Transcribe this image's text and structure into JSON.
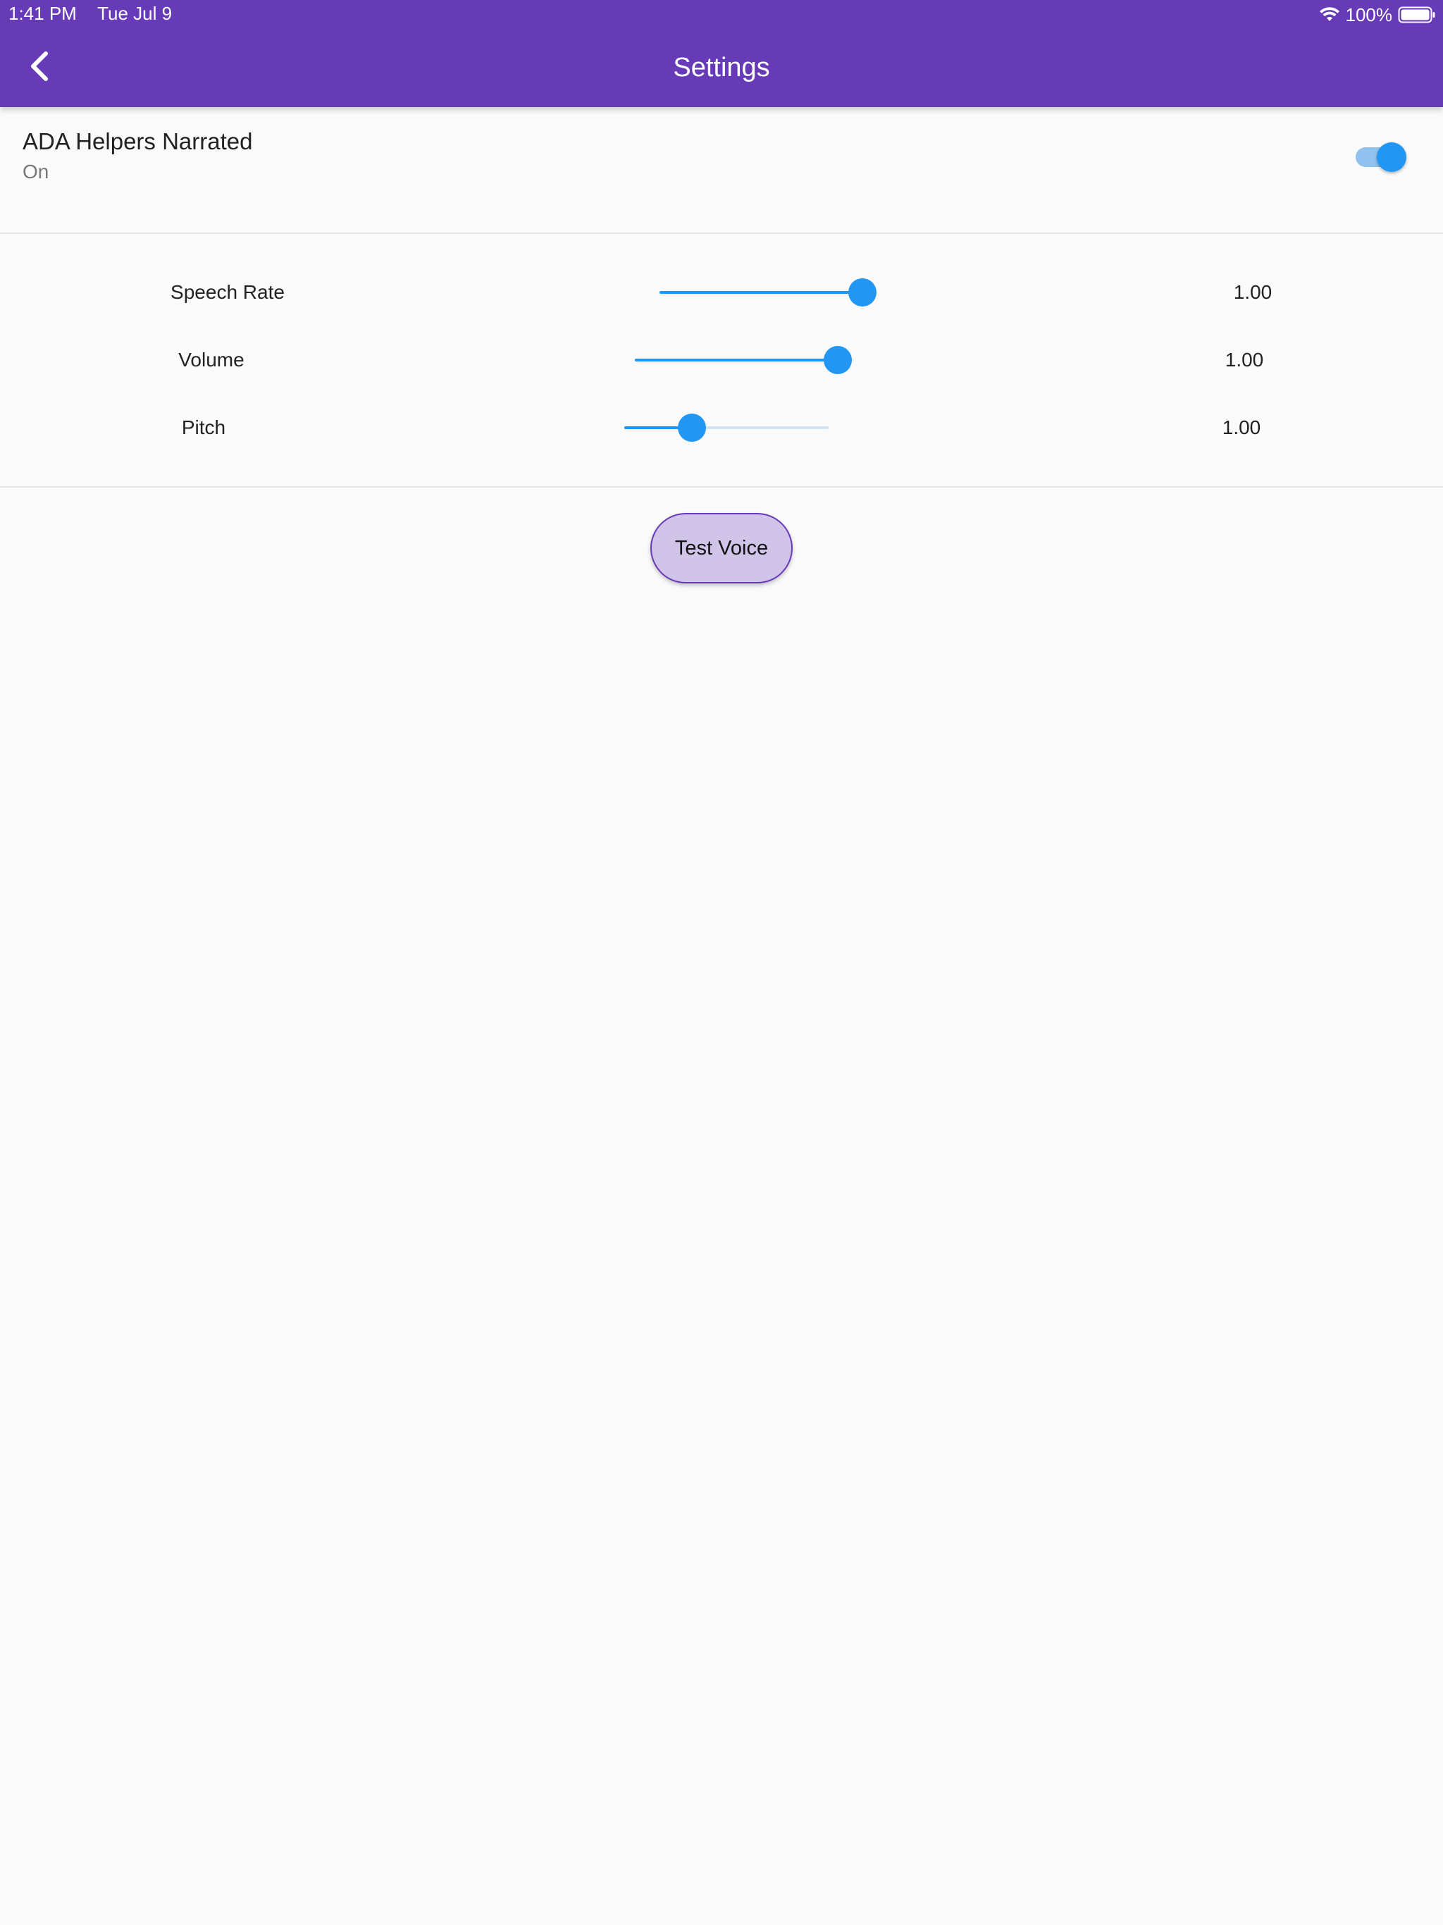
{
  "status_bar": {
    "time": "1:41 PM",
    "date": "Tue Jul 9",
    "battery_percent": "100%",
    "wifi_icon": "wifi-icon",
    "battery_icon": "battery-icon"
  },
  "app_bar": {
    "title": "Settings",
    "back_icon": "chevron-left-icon",
    "color": "#673ab7"
  },
  "narration_tile": {
    "title": "ADA Helpers Narrated",
    "subtitle": "On",
    "enabled": true
  },
  "sliders": [
    {
      "label": "Speech Rate",
      "value_text": "1.00",
      "fill_fraction": 1.0
    },
    {
      "label": "Volume",
      "value_text": "1.00",
      "fill_fraction": 1.0
    },
    {
      "label": "Pitch",
      "value_text": "1.00",
      "fill_fraction": 0.33
    }
  ],
  "test_voice_button": {
    "label": "Test Voice"
  },
  "colors": {
    "accent": "#2196f3",
    "primary": "#673ab7",
    "button_fill": "#d1c4e9"
  }
}
